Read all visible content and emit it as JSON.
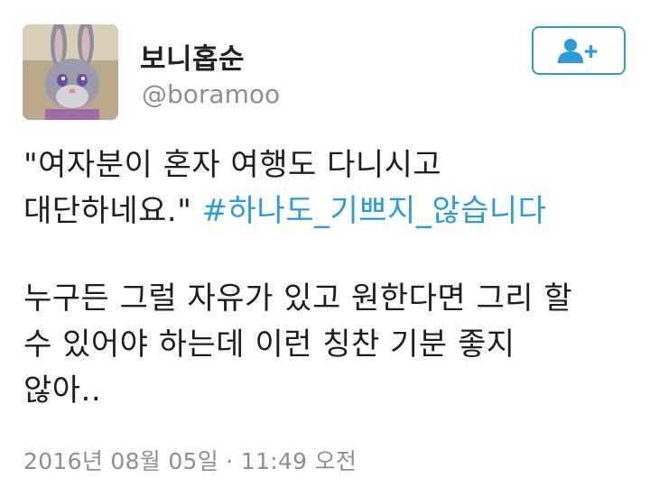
{
  "profile": {
    "display_name": "보니홉순",
    "handle": "@boramoo",
    "avatar_icon": "bunny-avatar"
  },
  "follow_button": {
    "icon": "add-user-icon",
    "accent_color": "#2b9bdc"
  },
  "tweet": {
    "line1": "\"여자분이 혼자 여행도 다니시고",
    "line2_text": "대단하네요.\" ",
    "hashtag": "#하나도_기쁘지_않습니다",
    "line3": "누구든 그럴 자유가 있고 원한다면 그리 할",
    "line4": "수 있어야 하는데 이런 칭찬 기분 좋지",
    "line5": "않아.."
  },
  "timestamp": "2016년 08월 05일 · 11:49 오전"
}
